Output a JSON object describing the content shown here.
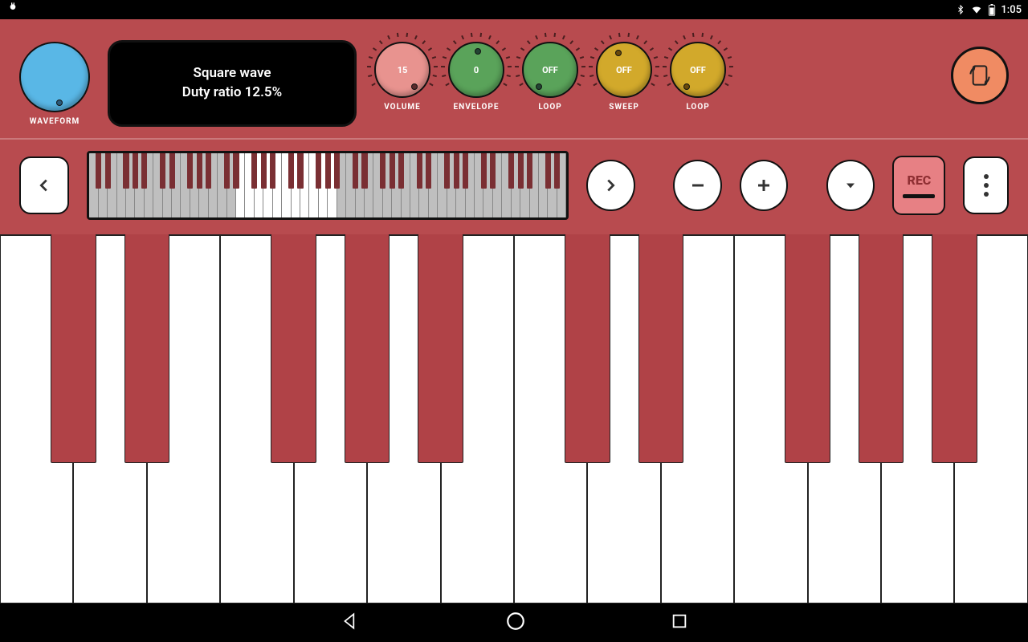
{
  "status": {
    "time": "1:05"
  },
  "colors": {
    "knob_waveform": "#59b7e6",
    "knob_volume": "#e8938f",
    "knob_envelope": "#5aa35a",
    "knob_loop1": "#5aa35a",
    "knob_sweep": "#d2a92b",
    "knob_loop2": "#d2a92b",
    "accent": "#b84b4f"
  },
  "knobs": {
    "waveform": {
      "label": "WAVEFORM",
      "value": ""
    },
    "volume": {
      "label": "VOLUME",
      "value": "15"
    },
    "envelope": {
      "label": "ENVELOPE",
      "value": "0"
    },
    "loop1": {
      "label": "LOOP",
      "value": "OFF"
    },
    "sweep": {
      "label": "SWEEP",
      "value": "OFF"
    },
    "loop2": {
      "label": "LOOP",
      "value": "OFF"
    }
  },
  "display": {
    "line1": "Square wave",
    "line2": "Duty ratio 12.5%"
  },
  "toolbar": {
    "rec_label": "REC"
  },
  "mini_keyboard": {
    "total_white": 52,
    "highlight_start": 17,
    "highlight_end": 27
  },
  "keyboard": {
    "white_keys": 14,
    "black_positions": [
      0,
      1,
      3,
      4,
      5,
      7,
      8,
      10,
      11,
      12
    ]
  }
}
